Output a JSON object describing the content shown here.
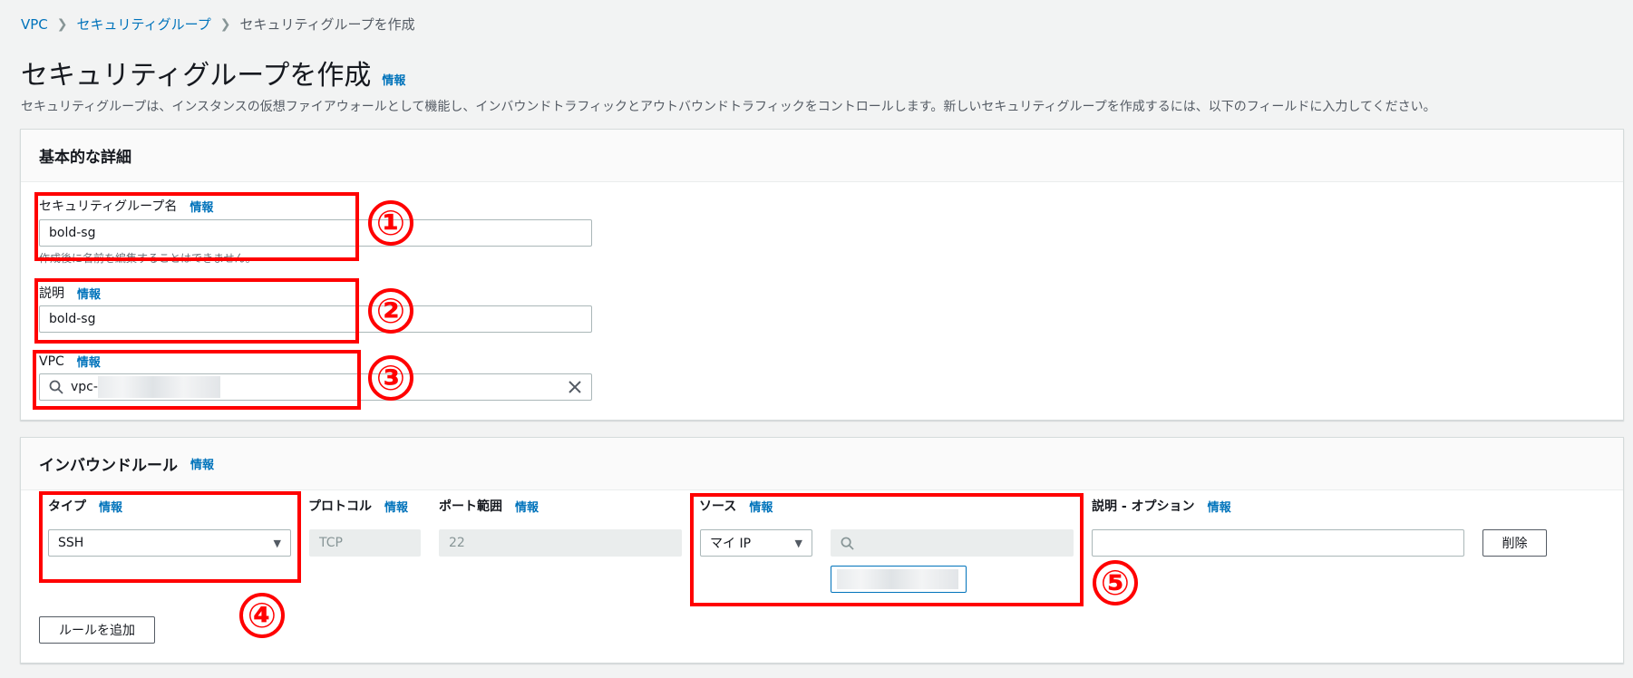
{
  "breadcrumb": {
    "items": [
      "VPC",
      "セキュリティグループ"
    ],
    "current": "セキュリティグループを作成"
  },
  "page": {
    "title": "セキュリティグループを作成",
    "info": "情報",
    "description": "セキュリティグループは、インスタンスの仮想ファイアウォールとして機能し、インバウンドトラフィックとアウトバウンドトラフィックをコントロールします。新しいセキュリティグループを作成するには、以下のフィールドに入力してください。"
  },
  "basic": {
    "header": "基本的な詳細",
    "sg_name_label": "セキュリティグループ名",
    "sg_name_value": "bold-sg",
    "sg_name_hint": "作成後に名前を編集することはできません。",
    "desc_label": "説明",
    "desc_value": "bold-sg",
    "vpc_label": "VPC",
    "vpc_value": "vpc-"
  },
  "inbound": {
    "header": "インバウンドルール",
    "type_label": "タイプ",
    "protocol_label": "プロトコル",
    "port_label": "ポート範囲",
    "source_label": "ソース",
    "desc_label": "説明 - オプション",
    "type_value": "SSH",
    "protocol_value": "TCP",
    "port_value": "22",
    "source_value": "マイ IP",
    "delete_label": "削除",
    "add_rule_label": "ルールを追加"
  },
  "info": "情報",
  "annotations": [
    "①",
    "②",
    "③",
    "④",
    "⑤"
  ],
  "colors": {
    "annotation": "#ff0000",
    "link": "#0073bb"
  },
  "icons": [
    "chevron-right-icon",
    "search-icon",
    "clear-icon",
    "caret-down-icon"
  ]
}
